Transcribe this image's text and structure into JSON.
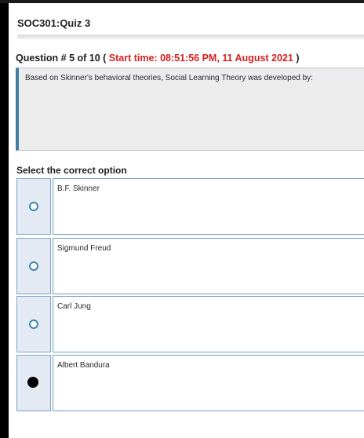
{
  "quiz": {
    "title": "SOC301:Quiz 3"
  },
  "question": {
    "number_label": "Question # 5 of 10 (",
    "start_time_label": "Start time: 08:51:56 PM, 11 August 2021",
    "closing_paren": ")",
    "text": "Based on Skinner's behavioral theories, Social Learning Theory was developed by:"
  },
  "options": {
    "heading": "Select the correct option",
    "items": [
      {
        "label": "B.F. Skinner",
        "selected": false
      },
      {
        "label": "Sigmund Freud",
        "selected": false
      },
      {
        "label": "Carl Jung",
        "selected": false
      },
      {
        "label": "Albert Bandura",
        "selected": true
      }
    ]
  },
  "colors": {
    "start_time": "#d42020",
    "radio_border": "#3d87ad",
    "question_accent": "#3f7da1"
  }
}
